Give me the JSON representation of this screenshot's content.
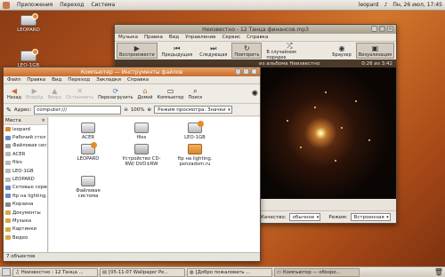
{
  "top_panel": {
    "menus": [
      "Приложения",
      "Переход",
      "Система"
    ],
    "user": "leopard",
    "clock": "Пн, 26 июл, 17:45"
  },
  "desktop_icons": [
    {
      "label": "LEOPARD"
    },
    {
      "label": "LEO-1GB"
    }
  ],
  "player": {
    "title": "Неизвестно - 12 Танца финансов.mp3",
    "menu": [
      "Музыка",
      "Правка",
      "Вид",
      "Управление",
      "Сервис",
      "Справка"
    ],
    "toolbar": [
      {
        "label": "Воспроизвести",
        "icon": "play-icon",
        "pressed": true
      },
      {
        "label": "Предыдущая",
        "icon": "previous-icon",
        "pressed": false
      },
      {
        "label": "Следующая",
        "icon": "next-icon",
        "pressed": false
      },
      {
        "label": "Повторить",
        "icon": "repeat-icon",
        "pressed": true
      },
      {
        "label": "В случайном порядке",
        "icon": "shuffle-icon",
        "pressed": false
      },
      {
        "label": "Браузер",
        "icon": "browser-icon",
        "pressed": false
      },
      {
        "label": "Визуализация",
        "icon": "visualization-icon",
        "pressed": true
      }
    ],
    "now_playing": "из альбома Неизвестно",
    "time": "0:26 из 3:42",
    "quality_label": "Качество:",
    "quality_value": "обычное",
    "mode_label": "Режим:",
    "mode_value": "Встроенная"
  },
  "file_manager": {
    "title": "Компьютер — Инструменты файлов",
    "menu": [
      "Файл",
      "Правка",
      "Вид",
      "Переход",
      "Закладки",
      "Справка"
    ],
    "toolbar": [
      {
        "label": "Назад",
        "icon": "back-icon",
        "disabled": false
      },
      {
        "label": "Вперёд",
        "icon": "forward-icon",
        "disabled": true
      },
      {
        "label": "Вверх",
        "icon": "up-icon",
        "disabled": true
      },
      {
        "label": "Остановить",
        "icon": "stop-icon",
        "disabled": true
      },
      {
        "label": "Перезагрузить",
        "icon": "reload-icon",
        "disabled": false
      },
      {
        "label": "Домой",
        "icon": "home-icon",
        "disabled": false
      },
      {
        "label": "Компьютер",
        "icon": "computer-icon",
        "disabled": false
      },
      {
        "label": "Поиск",
        "icon": "search-icon",
        "disabled": false
      }
    ],
    "address_label": "Адрес:",
    "address_value": "computer:///",
    "zoom": "100%",
    "view_mode": "Режим просмотра: Значки",
    "sidebar_title": "Места",
    "places": [
      {
        "label": "leopard",
        "color": "#d88a3a"
      },
      {
        "label": "Рабочий стол",
        "color": "#6a8ac8"
      },
      {
        "label": "Файловая систе",
        "color": "#9a9a9a"
      },
      {
        "label": "ACER",
        "color": "#b8b8b8"
      },
      {
        "label": "files",
        "color": "#b8b8b8"
      },
      {
        "label": "LEO-1GB",
        "color": "#b8b8b8"
      },
      {
        "label": "LEOPARD",
        "color": "#b8b8b8"
      },
      {
        "label": "Сетевые серве",
        "color": "#6a8ac8"
      },
      {
        "label": "ftp на lighting.pe",
        "color": "#6a8ac8"
      },
      {
        "label": "Корзина",
        "color": "#8a8a8a"
      },
      {
        "label": "Документы",
        "color": "#d8a848"
      },
      {
        "label": "Музыка",
        "color": "#d8a848"
      },
      {
        "label": "Картинки",
        "color": "#d8a848"
      },
      {
        "label": "Видео",
        "color": "#d8a848"
      }
    ],
    "items": [
      {
        "label": "ACER",
        "kind": "hdd"
      },
      {
        "label": "files",
        "kind": "hdd"
      },
      {
        "label": "LEO-1GB",
        "kind": "hdd-badge"
      },
      {
        "label": "LEOPARD",
        "kind": "hdd-badge"
      },
      {
        "label": "Устройство CD-RW/ DVD±RW",
        "kind": "cdrom"
      },
      {
        "label": "ftp на lighting. penzadom.ru",
        "kind": "folder"
      },
      {
        "label": "Файловая система",
        "kind": "hdd"
      }
    ],
    "status": "7 объектов"
  },
  "taskbar": [
    {
      "label": "Неизвестно - 12 Танца ...",
      "active": false
    },
    {
      "label": "[05-11-07 Wallpaper Pe...",
      "active": false
    },
    {
      "label": "[Добро пожаловать ...",
      "active": false
    },
    {
      "label": "Компьютер — обозре...",
      "active": true
    }
  ],
  "colors": {
    "accent": "#c86c2c",
    "panel": "#ece8e0"
  }
}
